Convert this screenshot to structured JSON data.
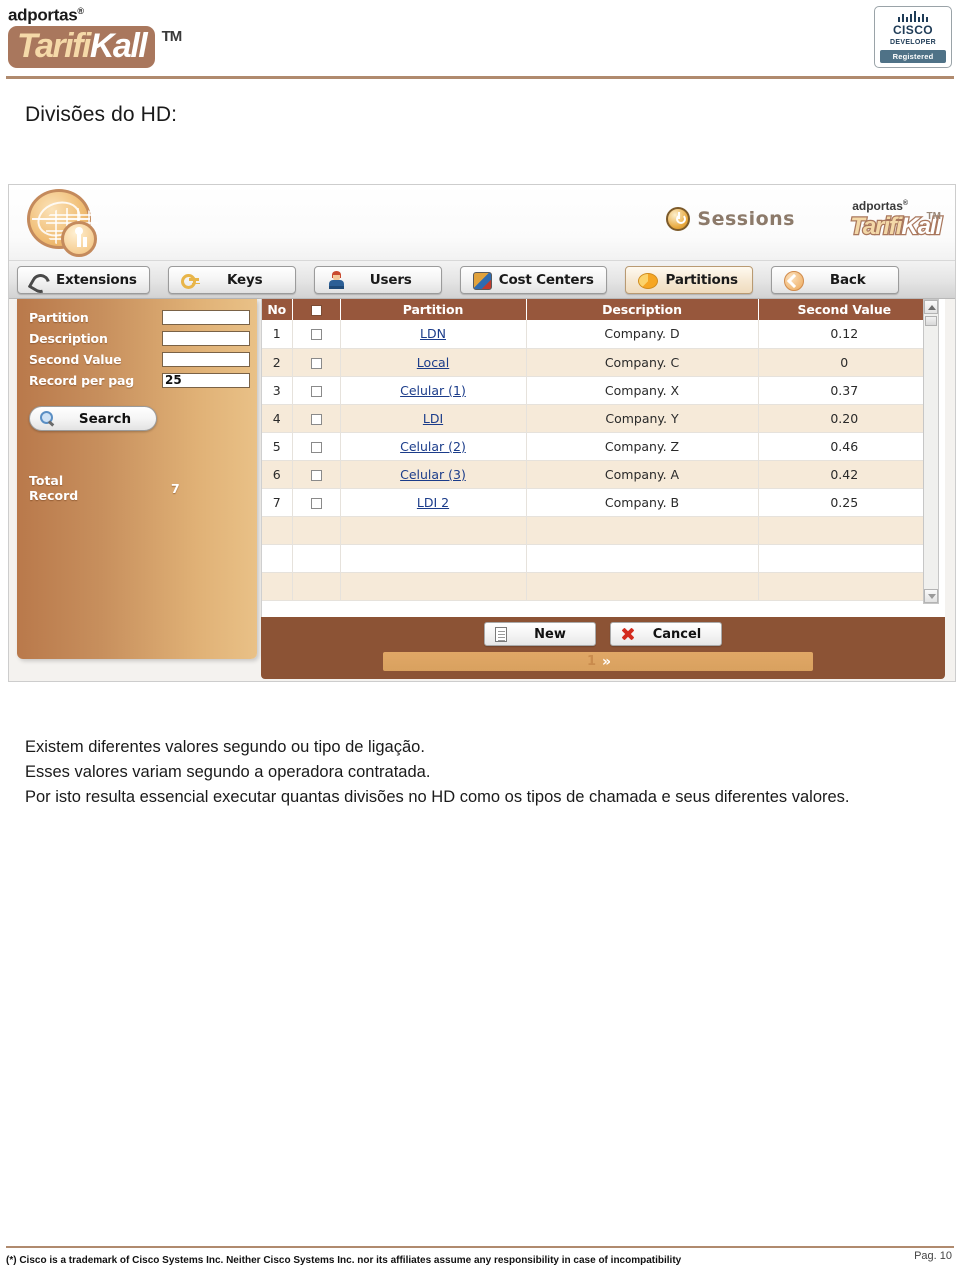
{
  "header": {
    "brand_company": "adportas",
    "brand_company_reg": "®",
    "brand_product_part1": "Tarifi",
    "brand_product_part2": "Kall",
    "brand_tm": "TM",
    "cisco": {
      "name": "CISCO",
      "program": "DEVELOPER",
      "status": "Registered"
    }
  },
  "section": {
    "title": "Divisões do HD:"
  },
  "app": {
    "sessions_label": "Sessions",
    "brand_company": "adportas",
    "brand_company_reg": "®",
    "brand_product_part1": "Tarifi",
    "brand_product_part2": "Kall",
    "brand_tm": "TM",
    "toolbar": [
      {
        "label": "Extensions",
        "icon": "phone-icon",
        "active": false
      },
      {
        "label": "Keys",
        "icon": "key-icon",
        "active": false
      },
      {
        "label": "Users",
        "icon": "user-icon",
        "active": false
      },
      {
        "label": "Cost Centers",
        "icon": "cost-centers-icon",
        "active": false
      },
      {
        "label": "Partitions",
        "icon": "pie-chart-icon",
        "active": true
      },
      {
        "label": "Back",
        "icon": "back-arrow-icon",
        "active": false
      }
    ],
    "sidebar": {
      "fields": [
        {
          "label": "Partition",
          "value": ""
        },
        {
          "label": "Description",
          "value": ""
        },
        {
          "label": "Second Value",
          "value": ""
        },
        {
          "label": "Record per pag",
          "value": "25"
        }
      ],
      "search_label": "Search",
      "total_record_label": "Total Record",
      "total_record_value": "7"
    },
    "table": {
      "columns": [
        "No",
        "",
        "Partition",
        "Description",
        "Second Value"
      ],
      "rows": [
        {
          "no": "1",
          "partition": "LDN",
          "description": "Company. D",
          "second_value": "0.12"
        },
        {
          "no": "2",
          "partition": "Local",
          "description": "Company. C",
          "second_value": "0"
        },
        {
          "no": "3",
          "partition": "Celular (1)",
          "description": "Company. X",
          "second_value": "0.37"
        },
        {
          "no": "4",
          "partition": "LDI",
          "description": "Company. Y",
          "second_value": "0.20"
        },
        {
          "no": "5",
          "partition": "Celular (2)",
          "description": "Company. Z",
          "second_value": "0.46"
        },
        {
          "no": "6",
          "partition": "Celular (3)",
          "description": "Company. A",
          "second_value": "0.42"
        },
        {
          "no": "7",
          "partition": "LDI 2",
          "description": "Company. B",
          "second_value": "0.25"
        }
      ],
      "empty_rows": 3
    },
    "actions": {
      "new_label": "New",
      "cancel_label": "Cancel"
    },
    "pagination": {
      "current_page": "1",
      "next_label": "»"
    }
  },
  "body": {
    "line1": "Existem diferentes valores segundo ou tipo de ligação.",
    "line2": "Esses valores variam segundo a operadora contratada.",
    "line3": "Por isto resulta essencial executar quantas divisões no HD como os tipos de chamada e seus diferentes valores."
  },
  "footer": {
    "note": "(*) Cisco is a trademark of Cisco Systems Inc. Neither Cisco Systems Inc. nor its affiliates assume any responsibility in case of incompatibility",
    "page": "Pag. 10"
  }
}
